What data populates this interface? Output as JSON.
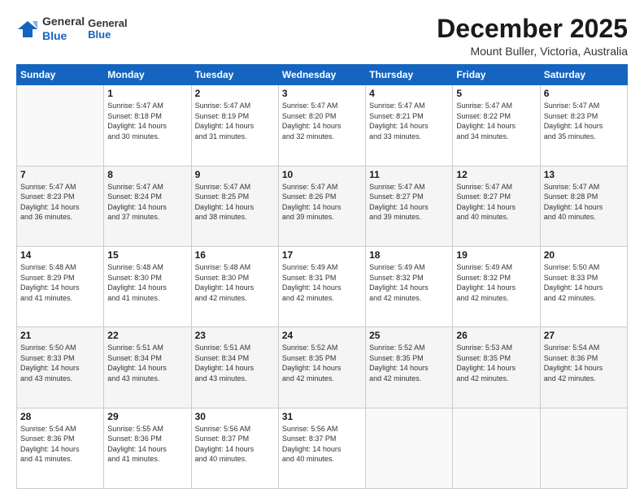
{
  "header": {
    "logo_general": "General",
    "logo_blue": "Blue",
    "month": "December 2025",
    "location": "Mount Buller, Victoria, Australia"
  },
  "weekdays": [
    "Sunday",
    "Monday",
    "Tuesday",
    "Wednesday",
    "Thursday",
    "Friday",
    "Saturday"
  ],
  "weeks": [
    [
      {
        "day": "",
        "info": ""
      },
      {
        "day": "1",
        "info": "Sunrise: 5:47 AM\nSunset: 8:18 PM\nDaylight: 14 hours\nand 30 minutes."
      },
      {
        "day": "2",
        "info": "Sunrise: 5:47 AM\nSunset: 8:19 PM\nDaylight: 14 hours\nand 31 minutes."
      },
      {
        "day": "3",
        "info": "Sunrise: 5:47 AM\nSunset: 8:20 PM\nDaylight: 14 hours\nand 32 minutes."
      },
      {
        "day": "4",
        "info": "Sunrise: 5:47 AM\nSunset: 8:21 PM\nDaylight: 14 hours\nand 33 minutes."
      },
      {
        "day": "5",
        "info": "Sunrise: 5:47 AM\nSunset: 8:22 PM\nDaylight: 14 hours\nand 34 minutes."
      },
      {
        "day": "6",
        "info": "Sunrise: 5:47 AM\nSunset: 8:23 PM\nDaylight: 14 hours\nand 35 minutes."
      }
    ],
    [
      {
        "day": "7",
        "info": "Sunrise: 5:47 AM\nSunset: 8:23 PM\nDaylight: 14 hours\nand 36 minutes."
      },
      {
        "day": "8",
        "info": "Sunrise: 5:47 AM\nSunset: 8:24 PM\nDaylight: 14 hours\nand 37 minutes."
      },
      {
        "day": "9",
        "info": "Sunrise: 5:47 AM\nSunset: 8:25 PM\nDaylight: 14 hours\nand 38 minutes."
      },
      {
        "day": "10",
        "info": "Sunrise: 5:47 AM\nSunset: 8:26 PM\nDaylight: 14 hours\nand 39 minutes."
      },
      {
        "day": "11",
        "info": "Sunrise: 5:47 AM\nSunset: 8:27 PM\nDaylight: 14 hours\nand 39 minutes."
      },
      {
        "day": "12",
        "info": "Sunrise: 5:47 AM\nSunset: 8:27 PM\nDaylight: 14 hours\nand 40 minutes."
      },
      {
        "day": "13",
        "info": "Sunrise: 5:47 AM\nSunset: 8:28 PM\nDaylight: 14 hours\nand 40 minutes."
      }
    ],
    [
      {
        "day": "14",
        "info": "Sunrise: 5:48 AM\nSunset: 8:29 PM\nDaylight: 14 hours\nand 41 minutes."
      },
      {
        "day": "15",
        "info": "Sunrise: 5:48 AM\nSunset: 8:30 PM\nDaylight: 14 hours\nand 41 minutes."
      },
      {
        "day": "16",
        "info": "Sunrise: 5:48 AM\nSunset: 8:30 PM\nDaylight: 14 hours\nand 42 minutes."
      },
      {
        "day": "17",
        "info": "Sunrise: 5:49 AM\nSunset: 8:31 PM\nDaylight: 14 hours\nand 42 minutes."
      },
      {
        "day": "18",
        "info": "Sunrise: 5:49 AM\nSunset: 8:32 PM\nDaylight: 14 hours\nand 42 minutes."
      },
      {
        "day": "19",
        "info": "Sunrise: 5:49 AM\nSunset: 8:32 PM\nDaylight: 14 hours\nand 42 minutes."
      },
      {
        "day": "20",
        "info": "Sunrise: 5:50 AM\nSunset: 8:33 PM\nDaylight: 14 hours\nand 42 minutes."
      }
    ],
    [
      {
        "day": "21",
        "info": "Sunrise: 5:50 AM\nSunset: 8:33 PM\nDaylight: 14 hours\nand 43 minutes."
      },
      {
        "day": "22",
        "info": "Sunrise: 5:51 AM\nSunset: 8:34 PM\nDaylight: 14 hours\nand 43 minutes."
      },
      {
        "day": "23",
        "info": "Sunrise: 5:51 AM\nSunset: 8:34 PM\nDaylight: 14 hours\nand 43 minutes."
      },
      {
        "day": "24",
        "info": "Sunrise: 5:52 AM\nSunset: 8:35 PM\nDaylight: 14 hours\nand 42 minutes."
      },
      {
        "day": "25",
        "info": "Sunrise: 5:52 AM\nSunset: 8:35 PM\nDaylight: 14 hours\nand 42 minutes."
      },
      {
        "day": "26",
        "info": "Sunrise: 5:53 AM\nSunset: 8:35 PM\nDaylight: 14 hours\nand 42 minutes."
      },
      {
        "day": "27",
        "info": "Sunrise: 5:54 AM\nSunset: 8:36 PM\nDaylight: 14 hours\nand 42 minutes."
      }
    ],
    [
      {
        "day": "28",
        "info": "Sunrise: 5:54 AM\nSunset: 8:36 PM\nDaylight: 14 hours\nand 41 minutes."
      },
      {
        "day": "29",
        "info": "Sunrise: 5:55 AM\nSunset: 8:36 PM\nDaylight: 14 hours\nand 41 minutes."
      },
      {
        "day": "30",
        "info": "Sunrise: 5:56 AM\nSunset: 8:37 PM\nDaylight: 14 hours\nand 40 minutes."
      },
      {
        "day": "31",
        "info": "Sunrise: 5:56 AM\nSunset: 8:37 PM\nDaylight: 14 hours\nand 40 minutes."
      },
      {
        "day": "",
        "info": ""
      },
      {
        "day": "",
        "info": ""
      },
      {
        "day": "",
        "info": ""
      }
    ]
  ]
}
